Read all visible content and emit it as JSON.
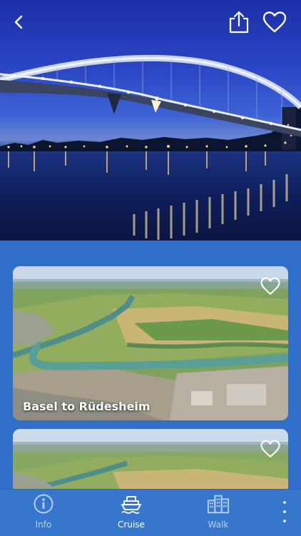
{
  "hero": {
    "back_icon": "chevron-left-icon",
    "share_icon": "share-icon",
    "favorite_icon": "heart-outline-icon"
  },
  "cards": [
    {
      "title": "Basel to Rüdesheim",
      "favorite_icon": "heart-outline-icon"
    },
    {
      "title": "",
      "favorite_icon": "heart-outline-icon"
    }
  ],
  "nav": {
    "items": [
      {
        "label": "Info",
        "icon": "info-icon",
        "active": false
      },
      {
        "label": "Cruise",
        "icon": "ship-icon",
        "active": true
      },
      {
        "label": "Walk",
        "icon": "buildings-icon",
        "active": false
      }
    ],
    "more_icon": "more-vertical-icon"
  },
  "colors": {
    "background": "#2f6fc9",
    "nav_background": "#3677cd",
    "nav_active": "#ffffff",
    "nav_inactive": "#b9cff0"
  }
}
